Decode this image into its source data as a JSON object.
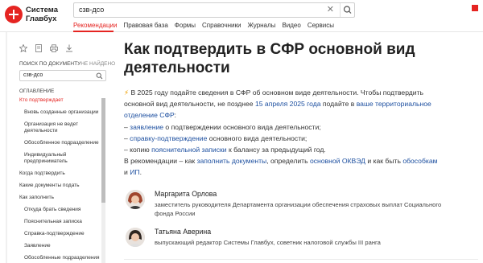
{
  "header": {
    "logo_line1": "Система",
    "logo_line2": "Главбух",
    "search_value": "сзв-дсо",
    "nav": [
      "Рекомендации",
      "Правовая база",
      "Формы",
      "Справочники",
      "Журналы",
      "Видео",
      "Сервисы"
    ],
    "accent_color": "#e52421"
  },
  "sidebar": {
    "tools": [
      "star-icon",
      "document-icon",
      "print-icon",
      "download-icon"
    ],
    "find_tab_1": "ПОИСК ПО ДОКУМЕНТУ",
    "find_tab_2": "НЕ НАЙДЕНО",
    "doc_search_value": "сзв-дсо",
    "toc_title": "ОГЛАВЛЕНИЕ",
    "toc": [
      {
        "label": "Кто подтверждает",
        "sub": false,
        "active": true
      },
      {
        "label": "Вновь созданные организации",
        "sub": true,
        "active": false
      },
      {
        "label": "Организация не ведет деятельности",
        "sub": true,
        "active": false
      },
      {
        "label": "Обособленное подразделение",
        "sub": true,
        "active": false
      },
      {
        "label": "Индивидуальный предприниматель",
        "sub": true,
        "active": false
      },
      {
        "label": "Когда подтвердить",
        "sub": false,
        "active": false
      },
      {
        "label": "Какие документы подать",
        "sub": false,
        "active": false
      },
      {
        "label": "Как заполнить",
        "sub": false,
        "active": false
      },
      {
        "label": "Откуда брать сведения",
        "sub": true,
        "active": false
      },
      {
        "label": "Пояснительная записка",
        "sub": true,
        "active": false
      },
      {
        "label": "Справка-подтверждение",
        "sub": true,
        "active": false
      },
      {
        "label": "Заявление",
        "sub": true,
        "active": false
      },
      {
        "label": "Обособленные подразделения",
        "sub": true,
        "active": false
      }
    ]
  },
  "main": {
    "title": "Как подтвердить в СФР основной вид деятельности",
    "p1_a": "В 2025 году подайте сведения в СФР об основном виде деятельности. Чтобы подтвердить основной вид деятельности, не позднее ",
    "p1_link": "15 апреля 2025 года",
    "p1_b": " подайте в ",
    "p1_link2": "ваше территориальное отделение СФР",
    "p1_c": ":",
    "li1_pre": "– ",
    "li1_link": "заявление",
    "li1_post": " о подтверждении основного вида деятельности;",
    "li2_pre": "– ",
    "li2_link": "справку-подтверждение",
    "li2_post": " основного вида деятельности;",
    "li3_pre": "– копию ",
    "li3_link": "пояснительной записки",
    "li3_post": " к балансу за предыдущий год.",
    "p2_a": "В рекомендации – как ",
    "p2_link1": "заполнить документы",
    "p2_b": ", определить ",
    "p2_link2": "основной ОКВЭД",
    "p2_c": " и как быть ",
    "p2_link3": "обособкам",
    "p2_d": " и ",
    "p2_link4": "ИП",
    "p2_e": ".",
    "persons": [
      {
        "name": "Маргарита Орлова",
        "role": "заместитель руководителя Департамента организации обеспечения страховых выплат Социального фонда России"
      },
      {
        "name": "Татьяна Аверина",
        "role": "выпускающий редактор Системы Главбух, советник налоговой службы III ранга"
      }
    ]
  }
}
